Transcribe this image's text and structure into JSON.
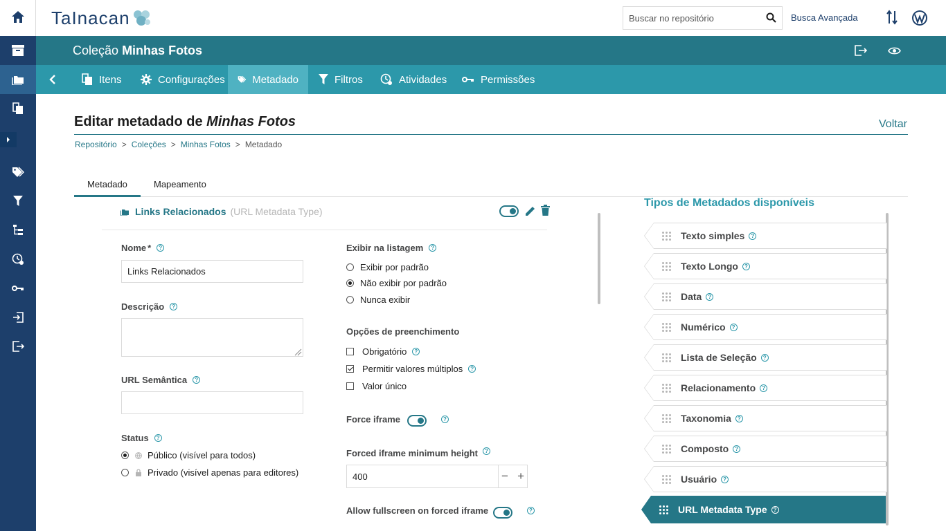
{
  "topbar": {
    "logo": "TaInacan",
    "search_placeholder": "Buscar no repositório",
    "advanced_search": "Busca Avançada"
  },
  "collection": {
    "prefix": "Coleção",
    "name": "Minhas Fotos"
  },
  "tabs": [
    {
      "label": "Itens",
      "icon": "items-icon"
    },
    {
      "label": "Configurações",
      "icon": "gear-icon"
    },
    {
      "label": "Metadado",
      "icon": "tags-icon"
    },
    {
      "label": "Filtros",
      "icon": "filter-icon"
    },
    {
      "label": "Atividades",
      "icon": "activity-icon"
    },
    {
      "label": "Permissões",
      "icon": "key-icon"
    }
  ],
  "page": {
    "title_prefix": "Editar metadado de",
    "title_collection": "Minhas Fotos",
    "back": "Voltar"
  },
  "breadcrumb": [
    "Repositório",
    "Coleções",
    "Minhas Fotos",
    "Metadado"
  ],
  "subtabs": [
    "Metadado",
    "Mapeamento"
  ],
  "metadata": {
    "name": "Links Relacionados",
    "type": "(URL Metadata Type)"
  },
  "form": {
    "name_label": "Nome",
    "required_mark": "*",
    "name_value": "Links Relacionados",
    "description_label": "Descrição",
    "description_value": "",
    "semantic_url_label": "URL Semântica",
    "semantic_url_value": "",
    "status_label": "Status",
    "status_options": [
      "Público (visível para todos)",
      "Privado (visível apenas para editores)"
    ],
    "status_selected": 0,
    "display_label": "Exibir na listagem",
    "display_options": [
      "Exibir por padrão",
      "Não exibir por padrão",
      "Nunca exibir"
    ],
    "display_selected": 1,
    "fill_label": "Opções de preenchimento",
    "fill_options": [
      {
        "label": "Obrigatório",
        "checked": false
      },
      {
        "label": "Permitir valores múltiplos",
        "checked": true
      },
      {
        "label": "Valor único",
        "checked": false
      }
    ],
    "force_iframe_label": "Force iframe",
    "force_iframe_on": true,
    "min_height_label": "Forced iframe minimum height",
    "min_height_value": "400",
    "minus": "−",
    "plus": "+",
    "fullscreen_label": "Allow fullscreen on forced iframe",
    "fullscreen_on": true
  },
  "types_panel": {
    "title": "Tipos de Metadados disponíveis",
    "items": [
      "Texto simples",
      "Texto Longo",
      "Data",
      "Numérico",
      "Lista de Seleção",
      "Relacionamento",
      "Taxonomia",
      "Composto",
      "Usuário",
      "URL Metadata Type"
    ],
    "selected": "URL Metadata Type"
  },
  "colors": {
    "sidebar": "#1d3f6b",
    "collection_bar": "#257787",
    "tab_bar": "#2c98aa",
    "accent": "#257787"
  }
}
